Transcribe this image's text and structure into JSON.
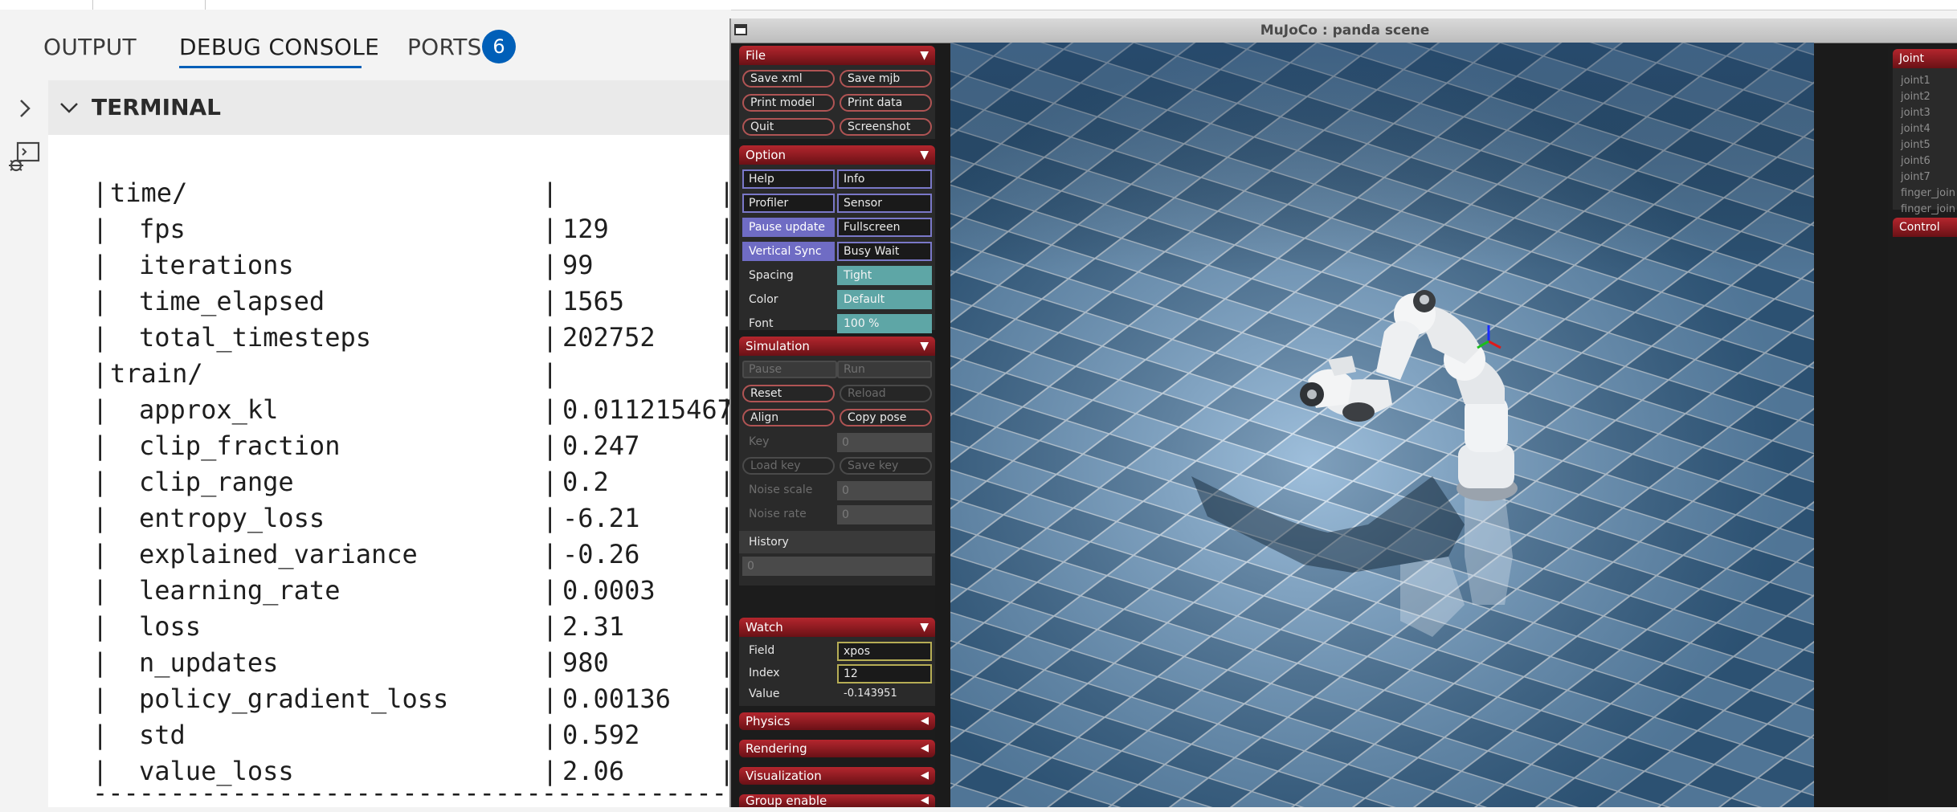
{
  "vscode": {
    "tabs": [
      {
        "label": "OUTPUT"
      },
      {
        "label": "DEBUG CONSOLE",
        "active": true
      },
      {
        "label": "PORTS"
      }
    ],
    "ports_badge": "6",
    "terminal_title": "TERMINAL",
    "terminal_lines": [
      {
        "key": "time/",
        "value": "",
        "indent": 0
      },
      {
        "key": "fps",
        "value": "129",
        "indent": 1
      },
      {
        "key": "iterations",
        "value": "99",
        "indent": 1
      },
      {
        "key": "time_elapsed",
        "value": "1565",
        "indent": 1
      },
      {
        "key": "total_timesteps",
        "value": "202752",
        "indent": 1
      },
      {
        "key": "train/",
        "value": "",
        "indent": 0
      },
      {
        "key": "approx_kl",
        "value": "0.011215467",
        "indent": 1
      },
      {
        "key": "clip_fraction",
        "value": "0.247",
        "indent": 1
      },
      {
        "key": "clip_range",
        "value": "0.2",
        "indent": 1
      },
      {
        "key": "entropy_loss",
        "value": "-6.21",
        "indent": 1
      },
      {
        "key": "explained_variance",
        "value": "-0.26",
        "indent": 1
      },
      {
        "key": "learning_rate",
        "value": "0.0003",
        "indent": 1
      },
      {
        "key": "loss",
        "value": "2.31",
        "indent": 1
      },
      {
        "key": "n_updates",
        "value": "980",
        "indent": 1
      },
      {
        "key": "policy_gradient_loss",
        "value": "0.00136",
        "indent": 1
      },
      {
        "key": "std",
        "value": "0.592",
        "indent": 1
      },
      {
        "key": "value_loss",
        "value": "2.06",
        "indent": 1
      }
    ],
    "terminal_dashes": "----------------------------------------------",
    "accent": "#005fb8"
  },
  "mujoco": {
    "title": "MuJoCo : panda scene",
    "file": {
      "header": "File",
      "buttons": [
        "Save xml",
        "Save mjb",
        "Print model",
        "Print data",
        "Quit",
        "Screenshot"
      ]
    },
    "option": {
      "header": "Option",
      "checks": [
        {
          "label": "Help",
          "on": false
        },
        {
          "label": "Info",
          "on": false
        },
        {
          "label": "Profiler",
          "on": false
        },
        {
          "label": "Sensor",
          "on": false
        },
        {
          "label": "Pause update",
          "on": true
        },
        {
          "label": "Fullscreen",
          "on": false
        },
        {
          "label": "Vertical Sync",
          "on": true
        },
        {
          "label": "Busy Wait",
          "on": false
        }
      ],
      "selects": [
        {
          "label": "Spacing",
          "value": "Tight"
        },
        {
          "label": "Color",
          "value": "Default"
        },
        {
          "label": "Font",
          "value": "100 %"
        }
      ]
    },
    "simulation": {
      "header": "Simulation",
      "pause": "Pause",
      "run": "Run",
      "reset": "Reset",
      "reload": "Reload",
      "align": "Align",
      "copy_pose": "Copy pose",
      "key_label": "Key",
      "key_value": "0",
      "load_key": "Load key",
      "save_key": "Save key",
      "noise_scale_label": "Noise scale",
      "noise_scale_value": "0",
      "noise_rate_label": "Noise rate",
      "noise_rate_value": "0",
      "history_label": "History",
      "history_value": "0"
    },
    "watch": {
      "header": "Watch",
      "field_label": "Field",
      "field_value": "xpos",
      "index_label": "Index",
      "index_value": "12",
      "value_label": "Value",
      "value_value": "-0.143951"
    },
    "collapsed_sections": [
      "Physics",
      "Rendering",
      "Visualization",
      "Group enable"
    ],
    "right_panel": {
      "joint_header": "Joint",
      "joints": [
        "joint1",
        "joint2",
        "joint3",
        "joint4",
        "joint5",
        "joint6",
        "joint7",
        "finger_join",
        "finger_join"
      ],
      "control_header": "Control"
    },
    "colors": {
      "section_red": "#b4262e",
      "check_on": "#6f6cc4",
      "select_teal": "#5ea6a6",
      "floor_dark": "#2c5a86",
      "floor_light": "#6a9cc8"
    }
  }
}
